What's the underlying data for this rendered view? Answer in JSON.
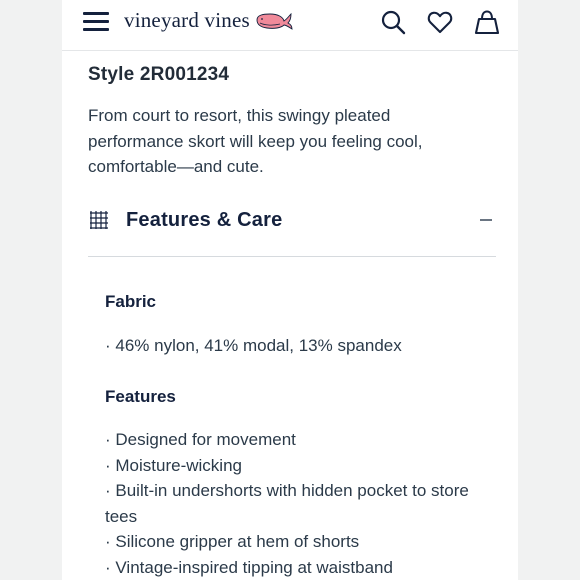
{
  "header": {
    "brand": "vineyard vines",
    "icons": [
      "menu-icon",
      "whale-logo-icon",
      "search-icon",
      "heart-icon",
      "bag-icon"
    ]
  },
  "product": {
    "style_label": "Style 2R001234",
    "description": "From court to resort, this swingy pleated performance skort will keep you feeling cool, comfortable—and cute."
  },
  "features_care": {
    "title": "Features & Care",
    "expanded": true,
    "fabric": {
      "heading": "Fabric",
      "items": [
        "46% nylon, 41% modal, 13% spandex"
      ]
    },
    "features": {
      "heading": "Features",
      "items": [
        "Designed for movement",
        "Moisture-wicking",
        "Built-in undershorts with hidden pocket to store tees",
        "Silicone gripper at hem of shorts",
        "Vintage-inspired tipping at waistband"
      ]
    }
  },
  "colors": {
    "navy": "#14213d",
    "whale_pink": "#f08a9a",
    "background": "#ffffff"
  }
}
